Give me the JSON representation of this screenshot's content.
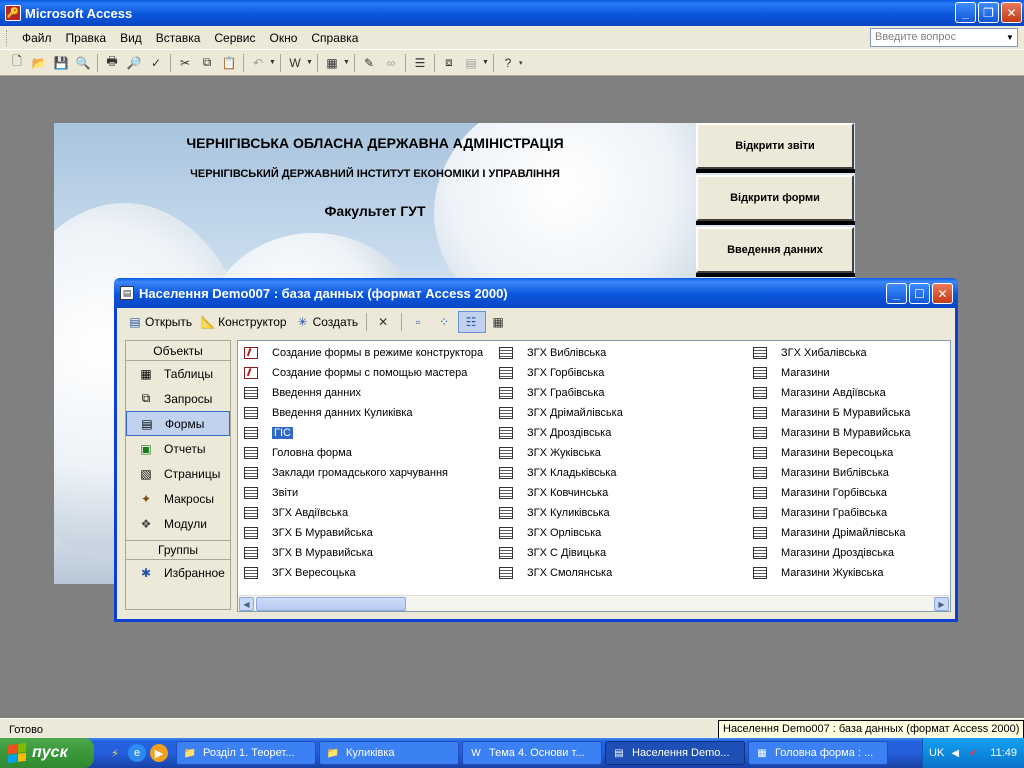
{
  "app": {
    "title": "Microsoft Access",
    "window_buttons": [
      "_",
      "❐",
      "✕"
    ]
  },
  "menubar": {
    "items": [
      "Файл",
      "Правка",
      "Вид",
      "Вставка",
      "Сервис",
      "Окно",
      "Справка"
    ],
    "ask_placeholder": "Введите вопрос"
  },
  "splash": {
    "line1": "ЧЕРНІГІВСЬКА ОБЛАСНА ДЕРЖАВНА АДМІНІСТРАЦІЯ",
    "line2": "ЧЕРНІГІВСЬКИЙ ДЕРЖАВНИЙ ІНСТИТУТ ЕКОНОМІКИ І УПРАВЛІННЯ",
    "line3": "Факультет ГУТ",
    "buttons": [
      "Відкрити звіти",
      "Відкрити форми",
      "Введення данних"
    ]
  },
  "dbwindow": {
    "title": "Населення Demo007 : база данных (формат Access 2000)",
    "toolbar": {
      "open": "Открыть",
      "design": "Конструктор",
      "create": "Создать"
    },
    "objects_header": "Объекты",
    "objects": [
      "Таблицы",
      "Запросы",
      "Формы",
      "Отчеты",
      "Страницы",
      "Макросы",
      "Модули"
    ],
    "selected_object": "Формы",
    "groups_header": "Группы",
    "groups": [
      "Избранное"
    ],
    "columns": [
      [
        {
          "label": "Создание формы в режиме конструктора",
          "kind": "wizard"
        },
        {
          "label": "Создание формы с помощью мастера",
          "kind": "wizard"
        },
        {
          "label": "Введення данних",
          "kind": "form"
        },
        {
          "label": "Введення данних Куликівка",
          "kind": "form"
        },
        {
          "label": "ГІС",
          "kind": "form",
          "selected": true
        },
        {
          "label": "Головна форма",
          "kind": "form"
        },
        {
          "label": "Заклади громадського харчування",
          "kind": "form"
        },
        {
          "label": "Звіти",
          "kind": "form"
        },
        {
          "label": "ЗГХ Авдіївська",
          "kind": "form"
        },
        {
          "label": "ЗГХ Б Муравийська",
          "kind": "form"
        },
        {
          "label": "ЗГХ В Муравийська",
          "kind": "form"
        },
        {
          "label": "ЗГХ Вересоцька",
          "kind": "form"
        }
      ],
      [
        {
          "label": "ЗГХ Виблівська",
          "kind": "form"
        },
        {
          "label": "ЗГХ Горбівська",
          "kind": "form"
        },
        {
          "label": "ЗГХ Грабівська",
          "kind": "form"
        },
        {
          "label": "ЗГХ Дрімайлівська",
          "kind": "form"
        },
        {
          "label": "ЗГХ Дроздівська",
          "kind": "form"
        },
        {
          "label": "ЗГХ Жуківська",
          "kind": "form"
        },
        {
          "label": "ЗГХ Кладьківська",
          "kind": "form"
        },
        {
          "label": "ЗГХ Ковчинська",
          "kind": "form"
        },
        {
          "label": "ЗГХ Куликівська",
          "kind": "form"
        },
        {
          "label": "ЗГХ Орлівська",
          "kind": "form"
        },
        {
          "label": "ЗГХ С Дівицька",
          "kind": "form"
        },
        {
          "label": "ЗГХ Смолянська",
          "kind": "form"
        }
      ],
      [
        {
          "label": "ЗГХ Хибалівська",
          "kind": "form"
        },
        {
          "label": "Магазини",
          "kind": "form"
        },
        {
          "label": "Магазини Авдіївська",
          "kind": "form"
        },
        {
          "label": "Магазини Б Муравийська",
          "kind": "form"
        },
        {
          "label": "Магазини В Муравийська",
          "kind": "form"
        },
        {
          "label": "Магазини Вересоцька",
          "kind": "form"
        },
        {
          "label": "Магазини Виблівська",
          "kind": "form"
        },
        {
          "label": "Магазини Горбівська",
          "kind": "form"
        },
        {
          "label": "Магазини Грабівська",
          "kind": "form"
        },
        {
          "label": "Магазини Дрімайлівська",
          "kind": "form"
        },
        {
          "label": "Магазини Дроздівська",
          "kind": "form"
        },
        {
          "label": "Магазини Жуківська",
          "kind": "form"
        }
      ]
    ]
  },
  "statusbar": {
    "text": "Готово",
    "tooltip": "Населення Demo007 : база данных (формат Access 2000)"
  },
  "taskbar": {
    "start": "пуск",
    "tasks": [
      {
        "label": "Розділ 1. Теорет...",
        "icon": "folder-icon",
        "active": false
      },
      {
        "label": "Куликівка",
        "icon": "folder-icon",
        "active": false
      },
      {
        "label": "Тема 4. Основи т...",
        "icon": "word-icon",
        "active": false
      },
      {
        "label": "Населення Demo...",
        "icon": "access-db-icon",
        "active": true
      },
      {
        "label": "Головна форма : ...",
        "icon": "access-form-icon",
        "active": false
      }
    ],
    "lang": "UK",
    "clock": "11:49"
  }
}
